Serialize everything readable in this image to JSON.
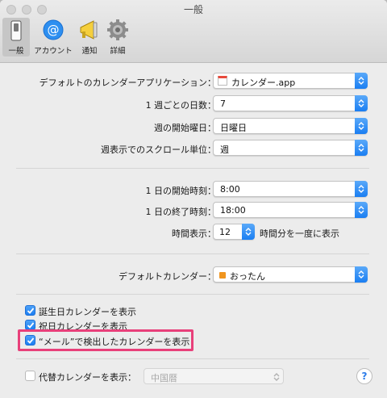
{
  "window": {
    "title": "一般"
  },
  "toolbar": {
    "tabs": [
      {
        "label": "一般",
        "icon": "switch-icon",
        "selected": true
      },
      {
        "label": "アカウント",
        "icon": "at-sign-icon"
      },
      {
        "label": "通知",
        "icon": "megaphone-icon"
      },
      {
        "label": "詳細",
        "icon": "gear-icon"
      }
    ]
  },
  "settings": {
    "default_app_label": "デフォルトのカレンダーアプリケーション：",
    "default_app_value": "カレンダー.app",
    "days_per_week_label": "1 週ごとの日数：",
    "days_per_week_value": "7",
    "week_start_label": "週の開始曜日：",
    "week_start_value": "日曜日",
    "scroll_unit_label": "週表示でのスクロール単位：",
    "scroll_unit_value": "週",
    "day_start_label": "1 日の開始時刻：",
    "day_start_value": "8:00",
    "day_end_label": "1 日の終了時刻：",
    "day_end_value": "18:00",
    "hours_label": "時間表示：",
    "hours_value": "12",
    "hours_suffix": "時間分を一度に表示",
    "default_calendar_label": "デフォルトカレンダー：",
    "default_calendar_value": "おったん"
  },
  "checkboxes": [
    {
      "label": "誕生日カレンダーを表示",
      "checked": true
    },
    {
      "label": "祝日カレンダーを表示",
      "checked": true
    },
    {
      "label": "“メール”で検出したカレンダーを表示",
      "checked": true
    }
  ],
  "alt_calendar": {
    "label": "代替カレンダーを表示：",
    "checked": false,
    "value": "中国暦"
  },
  "help": {
    "label": "?"
  },
  "colors": {
    "accent": "#1c7ef2",
    "highlight": "#e8407a",
    "calendar_swatch": "#f0951f"
  }
}
